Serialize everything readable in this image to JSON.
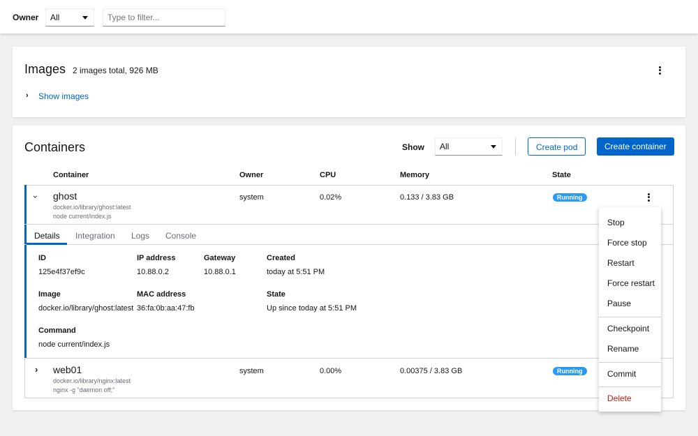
{
  "toolbar": {
    "owner_label": "Owner",
    "owner_value": "All",
    "filter_placeholder": "Type to filter..."
  },
  "images": {
    "title": "Images",
    "summary": "2 images total, 926 MB",
    "toggle": "Show images"
  },
  "containers": {
    "title": "Containers",
    "show_label": "Show",
    "show_value": "All",
    "create_pod": "Create pod",
    "create_container": "Create container",
    "columns": [
      "Container",
      "Owner",
      "CPU",
      "Memory",
      "State"
    ],
    "rows": [
      {
        "name": "ghost",
        "image": "docker.io/library/ghost:latest",
        "command": "node current/index.js",
        "owner": "system",
        "cpu": "0.02%",
        "memory": "0.133 / 3.83 GB",
        "state": "Running"
      },
      {
        "name": "web01",
        "image": "docker.io/library/nginx:latest",
        "command": "nginx -g \"daemon off;\"",
        "owner": "system",
        "cpu": "0.00%",
        "memory": "0.00375 / 3.83 GB",
        "state": "Running"
      }
    ],
    "tabs": [
      "Details",
      "Integration",
      "Logs",
      "Console"
    ],
    "details": {
      "id_label": "ID",
      "id": "125e4f37ef9c",
      "ip_label": "IP address",
      "ip": "10.88.0.2",
      "gw_label": "Gateway",
      "gw": "10.88.0.1",
      "created_label": "Created",
      "created": "today at 5:51 PM",
      "image_label": "Image",
      "image": "docker.io/library/ghost:latest",
      "mac_label": "MAC address",
      "mac": "36:fa:0b:aa:47:fb",
      "state_label": "State",
      "state": "Up since today at 5:51 PM",
      "command_label": "Command",
      "command": "node current/index.js"
    }
  },
  "menu": {
    "items": [
      "Stop",
      "Force stop",
      "Restart",
      "Force restart",
      "Pause",
      "Checkpoint",
      "Rename",
      "Commit",
      "Delete"
    ],
    "danger_color": "#c9190b"
  },
  "colors": {
    "accent": "#0066cc",
    "badge": "#2b9af3"
  }
}
